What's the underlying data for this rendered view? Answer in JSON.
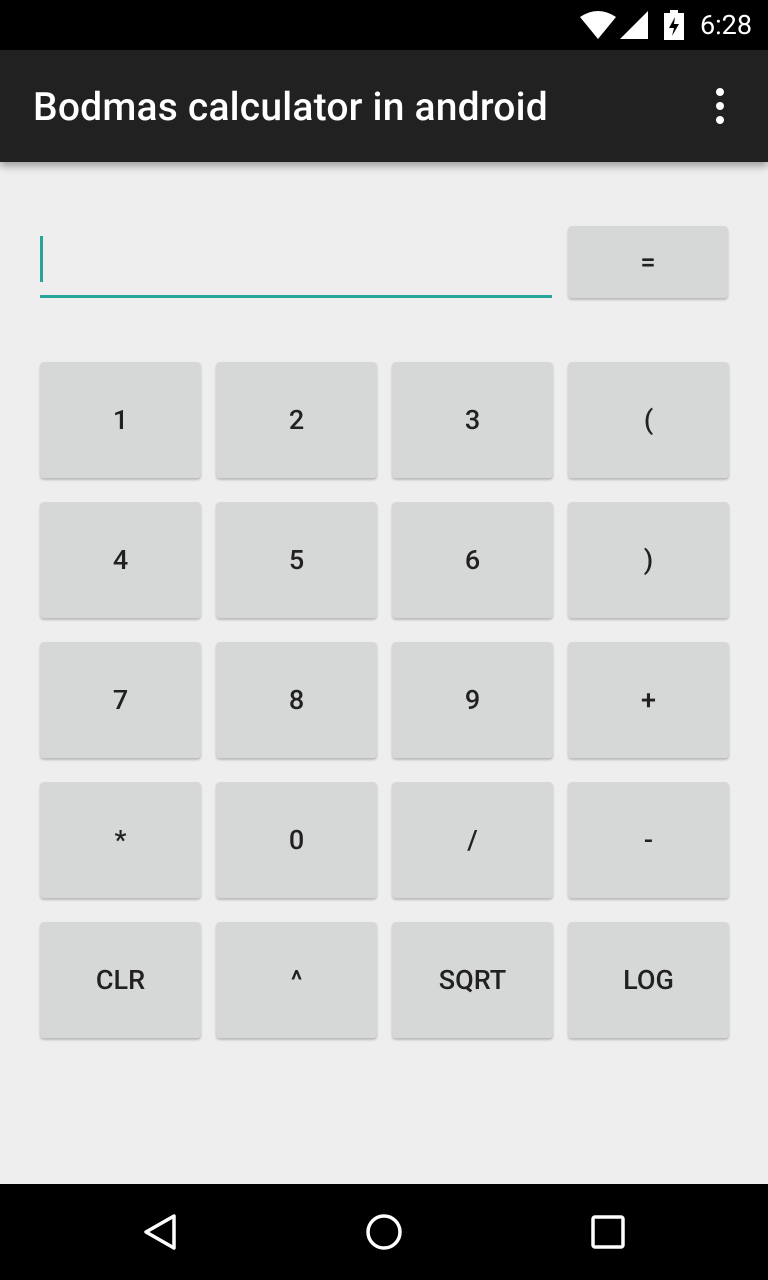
{
  "status_bar": {
    "time": "6:28",
    "icons": [
      "wifi-icon",
      "cell-signal-icon",
      "battery-charging-icon"
    ]
  },
  "app_bar": {
    "title": "Bodmas calculator in android",
    "overflow_icon": "more-vert-icon"
  },
  "input": {
    "value": "",
    "equals_label": "="
  },
  "keypad": {
    "rows": [
      [
        "1",
        "2",
        "3",
        "("
      ],
      [
        "4",
        "5",
        "6",
        ")"
      ],
      [
        "7",
        "8",
        "9",
        "+"
      ],
      [
        "*",
        "0",
        "/",
        "-"
      ],
      [
        "CLR",
        "^",
        "SQRT",
        "LOG"
      ]
    ]
  },
  "nav_bar": {
    "icons": [
      "back-icon",
      "home-icon",
      "recents-icon"
    ]
  },
  "colors": {
    "accent": "#26a69a",
    "app_bar": "#212121",
    "background": "#eeeeee",
    "button": "#d6d7d7"
  }
}
